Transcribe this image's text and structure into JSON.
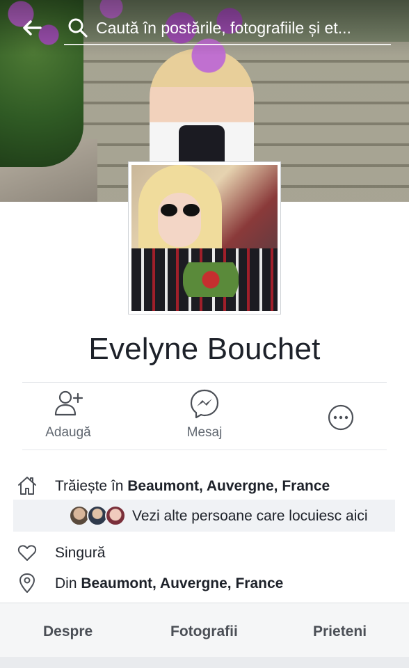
{
  "header": {
    "back_icon": "back-arrow-icon",
    "search_icon": "search-icon",
    "search_placeholder": "Caută în postările, fotografiile și et..."
  },
  "profile": {
    "name": "Evelyne Bouchet"
  },
  "actions": [
    {
      "label": "Adaugă",
      "icon": "add-friend-icon"
    },
    {
      "label": "Mesaj",
      "icon": "messenger-icon"
    },
    {
      "label": "",
      "icon": "more-options-icon"
    }
  ],
  "info": {
    "lives_prefix": "Trăiește în ",
    "lives_place": "Beaumont, Auvergne, France",
    "people_link": "Vezi alte persoane care locuiesc aici",
    "relationship": "Singură",
    "from_prefix": "Din ",
    "from_place": "Beaumont, Auvergne, France"
  },
  "tabs": [
    {
      "label": "Despre"
    },
    {
      "label": "Fotografii"
    },
    {
      "label": "Prieteni"
    }
  ],
  "colors": {
    "text_primary": "#1d2129",
    "text_secondary": "#606770",
    "icon_gray": "#4b4f56",
    "strip_bg": "#f0f2f5"
  }
}
